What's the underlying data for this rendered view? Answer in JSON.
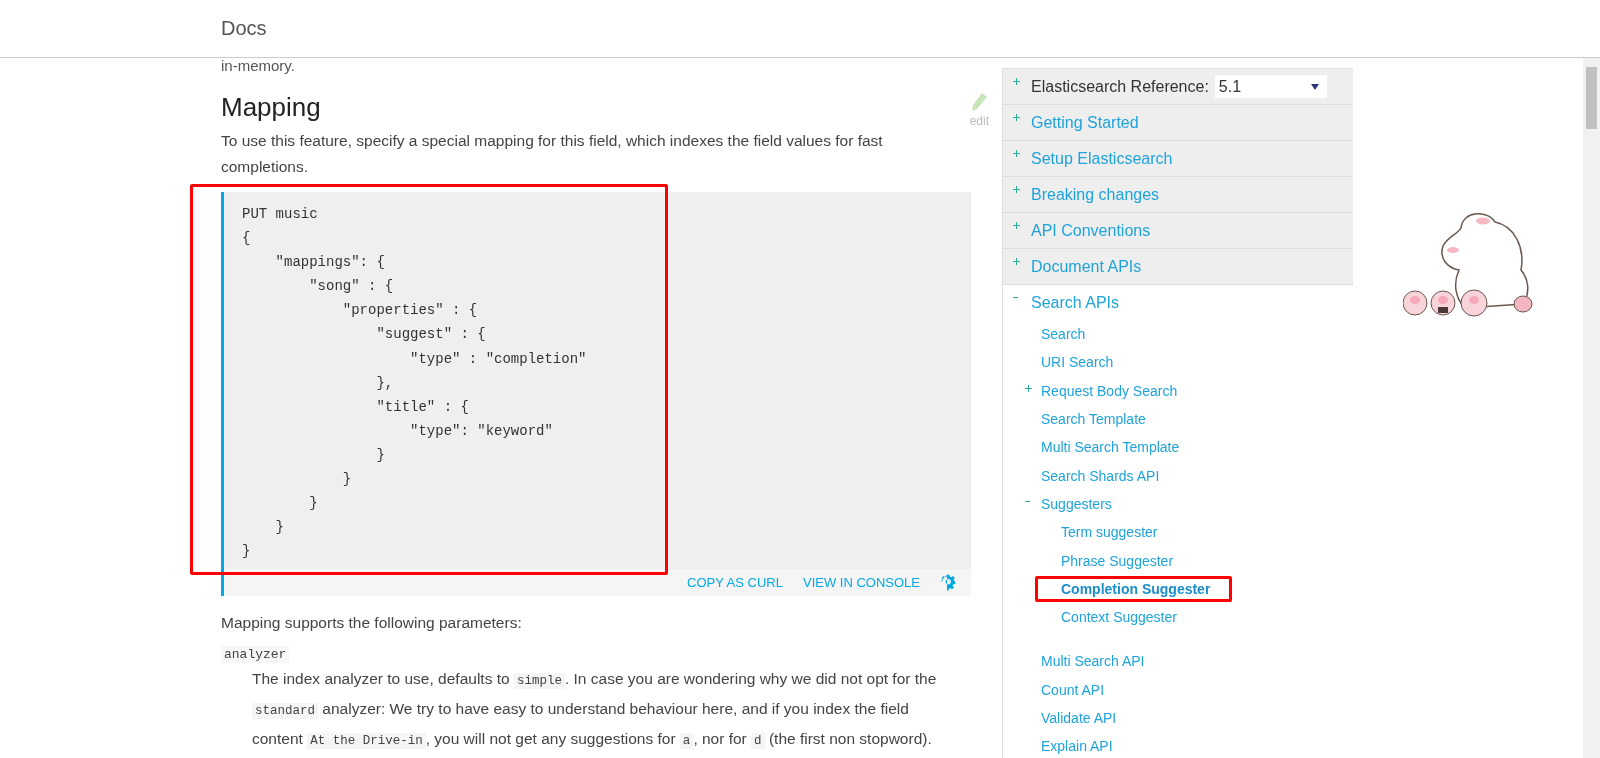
{
  "header": {
    "title": "Docs"
  },
  "article": {
    "intro_fragment": "in-memory.",
    "heading": "Mapping",
    "edit_label": "edit",
    "paragraph": "To use this feature, specify a special mapping for this field, which indexes the field values for fast completions.",
    "code": {
      "highlighted": true,
      "lines": [
        "PUT music",
        "{",
        "    \"mappings\": {",
        "        \"song\" : {",
        "            \"properties\" : {",
        "                \"suggest\" : {",
        "                    \"type\" : \"completion\"",
        "                },",
        "                \"title\" : {",
        "                    \"type\": \"keyword\"",
        "                }",
        "            }",
        "        }",
        "    }",
        "}"
      ],
      "actions": [
        "COPY AS CURL",
        "VIEW IN CONSOLE"
      ]
    },
    "params_intro": "Mapping supports the following parameters:",
    "params": [
      {
        "name": "analyzer",
        "description": [
          {
            "kind": "text",
            "text": "The index analyzer to use, defaults to "
          },
          {
            "kind": "code",
            "text": "simple"
          },
          {
            "kind": "text",
            "text": ". In case you are wondering why we did not opt for the "
          },
          {
            "kind": "code",
            "text": "standard"
          },
          {
            "kind": "text",
            "text": " analyzer: We try to have easy to understand behaviour here, and if you index the field content "
          },
          {
            "kind": "code",
            "text": "At the Drive-in"
          },
          {
            "kind": "text",
            "text": ", you will not get any suggestions for "
          },
          {
            "kind": "code",
            "text": "a"
          },
          {
            "kind": "text",
            "text": ", nor for "
          },
          {
            "kind": "code",
            "text": "d"
          },
          {
            "kind": "text",
            "text": " (the first non stopword)."
          }
        ]
      }
    ]
  },
  "sidebar": {
    "version": {
      "label": "Elasticsearch Reference:",
      "value": "5.1"
    },
    "sections": [
      {
        "label": "Getting Started",
        "expanded": false
      },
      {
        "label": "Setup Elasticsearch",
        "expanded": false
      },
      {
        "label": "Breaking changes",
        "expanded": false
      },
      {
        "label": "API Conventions",
        "expanded": false
      },
      {
        "label": "Document APIs",
        "expanded": false
      },
      {
        "label": "Search APIs",
        "expanded": true,
        "children": [
          {
            "kind": "page",
            "label": "Search",
            "selected": false
          },
          {
            "kind": "page",
            "label": "URI Search",
            "selected": false
          },
          {
            "kind": "group",
            "label": "Request Body Search",
            "expanded": false
          },
          {
            "kind": "page",
            "label": "Search Template",
            "selected": false
          },
          {
            "kind": "page",
            "label": "Multi Search Template",
            "selected": false
          },
          {
            "kind": "page",
            "label": "Search Shards API",
            "selected": false
          },
          {
            "kind": "group",
            "label": "Suggesters",
            "expanded": true,
            "children": [
              {
                "kind": "page",
                "label": "Term suggester",
                "selected": false
              },
              {
                "kind": "page",
                "label": "Phrase Suggester",
                "selected": false
              },
              {
                "kind": "page",
                "label": "Completion Suggester",
                "selected": true,
                "highlighted": true
              },
              {
                "kind": "page",
                "label": "Context Suggester",
                "selected": false
              }
            ]
          },
          {
            "kind": "page",
            "label": "Multi Search API",
            "selected": false
          },
          {
            "kind": "page",
            "label": "Count API",
            "selected": false
          },
          {
            "kind": "page",
            "label": "Validate API",
            "selected": false
          },
          {
            "kind": "page",
            "label": "Explain API",
            "selected": false
          }
        ]
      }
    ]
  }
}
